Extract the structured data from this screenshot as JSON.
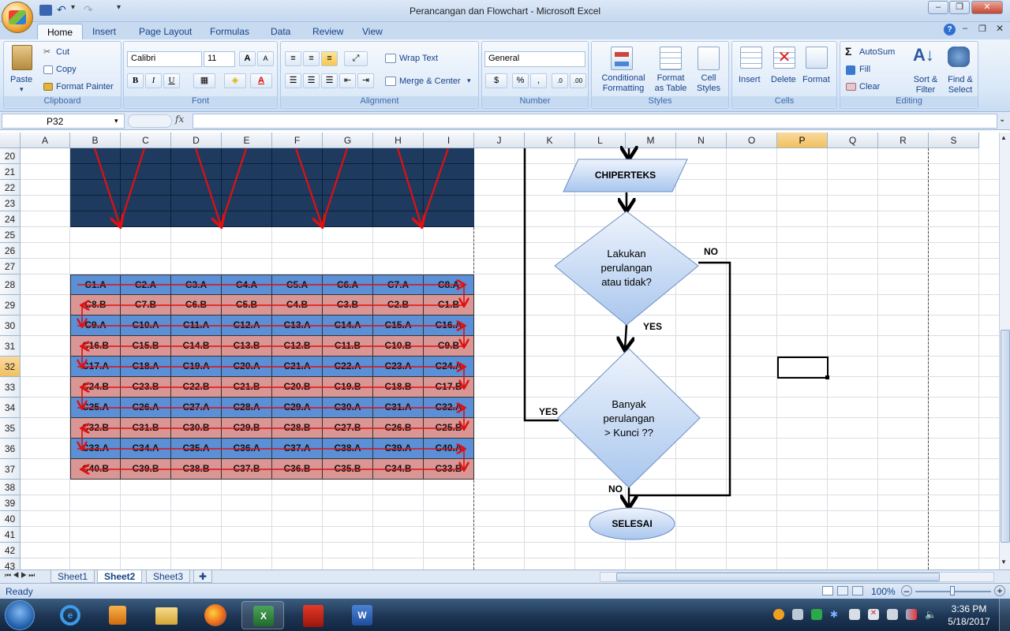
{
  "window": {
    "title": "Perancangan dan Flowchart - Microsoft Excel"
  },
  "tabs": [
    "Home",
    "Insert",
    "Page Layout",
    "Formulas",
    "Data",
    "Review",
    "View"
  ],
  "ribbon": {
    "clipboard": {
      "label": "Clipboard",
      "paste": "Paste",
      "cut": "Cut",
      "copy": "Copy",
      "format_painter": "Format Painter"
    },
    "font": {
      "label": "Font",
      "family": "Calibri",
      "size": "11",
      "bold": "B",
      "italic": "I",
      "underline": "U"
    },
    "alignment": {
      "label": "Alignment",
      "wrap_text": "Wrap Text",
      "merge_center": "Merge & Center"
    },
    "number": {
      "label": "Number",
      "format": "General",
      "currency": "$",
      "percent": "%",
      "comma": ","
    },
    "styles": {
      "label": "Styles",
      "conditional": "Conditional Formatting",
      "format_table": "Format as Table",
      "cell_styles": "Cell Styles"
    },
    "cells": {
      "label": "Cells",
      "insert": "Insert",
      "delete": "Delete",
      "format": "Format"
    },
    "editing": {
      "label": "Editing",
      "autosum": "AutoSum",
      "fill": "Fill",
      "clear": "Clear",
      "sort_filter": "Sort & Filter",
      "find_select": "Find & Select"
    }
  },
  "formula_bar": {
    "name_box": "P32",
    "fx": "fx",
    "value": ""
  },
  "columns": [
    "A",
    "B",
    "C",
    "D",
    "E",
    "F",
    "G",
    "H",
    "I",
    "J",
    "K",
    "L",
    "M",
    "N",
    "O",
    "P",
    "Q",
    "R",
    "S"
  ],
  "selected_column": "P",
  "rows": [
    "20",
    "21",
    "22",
    "23",
    "24",
    "25",
    "26",
    "27",
    "28",
    "29",
    "30",
    "31",
    "32",
    "33",
    "34",
    "35",
    "36",
    "37",
    "38",
    "39",
    "40",
    "41",
    "42",
    "43"
  ],
  "selected_row": "32",
  "table": [
    [
      "C1.A",
      "C2.A",
      "C3.A",
      "C4.A",
      "C5.A",
      "C6.A",
      "C7.A",
      "C8.A"
    ],
    [
      "C8.B",
      "C7.B",
      "C6.B",
      "C5.B",
      "C4.B",
      "C3.B",
      "C2.B",
      "C1.B"
    ],
    [
      "C9.A",
      "C10.A",
      "C11.A",
      "C12.A",
      "C13.A",
      "C14.A",
      "C15.A",
      "C16.A"
    ],
    [
      "C16.B",
      "C15.B",
      "C14.B",
      "C13.B",
      "C12.B",
      "C11.B",
      "C10.B",
      "C9.B"
    ],
    [
      "C17.A",
      "C18.A",
      "C19.A",
      "C20.A",
      "C21.A",
      "C22.A",
      "C23.A",
      "C24.A"
    ],
    [
      "C24.B",
      "C23.B",
      "C22.B",
      "C21.B",
      "C20.B",
      "C19.B",
      "C18.B",
      "C17.B"
    ],
    [
      "C25.A",
      "C26.A",
      "C27.A",
      "C28.A",
      "C29.A",
      "C30.A",
      "C31.A",
      "C32.A"
    ],
    [
      "C32.B",
      "C31.B",
      "C30.B",
      "C29.B",
      "C28.B",
      "C27.B",
      "C26.B",
      "C25.B"
    ],
    [
      "C33.A",
      "C34.A",
      "C35.A",
      "C36.A",
      "C37.A",
      "C38.A",
      "C39.A",
      "C40.A"
    ],
    [
      "C40.B",
      "C39.B",
      "C38.B",
      "C37.B",
      "C36.B",
      "C35.B",
      "C34.B",
      "C33.B"
    ]
  ],
  "colors": {
    "blue_row": "#5b8fd6",
    "pink_row": "#d99694",
    "dark_block": "#1f3a5f",
    "arrow": "#e01010"
  },
  "flowchart": {
    "io_label": "CHIPERTEKS",
    "decision1": [
      "Lakukan",
      "perulangan",
      "atau tidak?"
    ],
    "decision2": [
      "Banyak",
      "perulangan",
      "> Kunci  ??"
    ],
    "end_label": "SELESAI",
    "yes1": "YES",
    "no1": "NO",
    "yes2": "YES",
    "no2": "NO"
  },
  "sheets": [
    "Sheet1",
    "Sheet2",
    "Sheet3"
  ],
  "active_sheet": "Sheet2",
  "status": {
    "left": "Ready",
    "zoom": "100%"
  },
  "taskbar": {
    "time": "3:36 PM",
    "date": "5/18/2017"
  }
}
